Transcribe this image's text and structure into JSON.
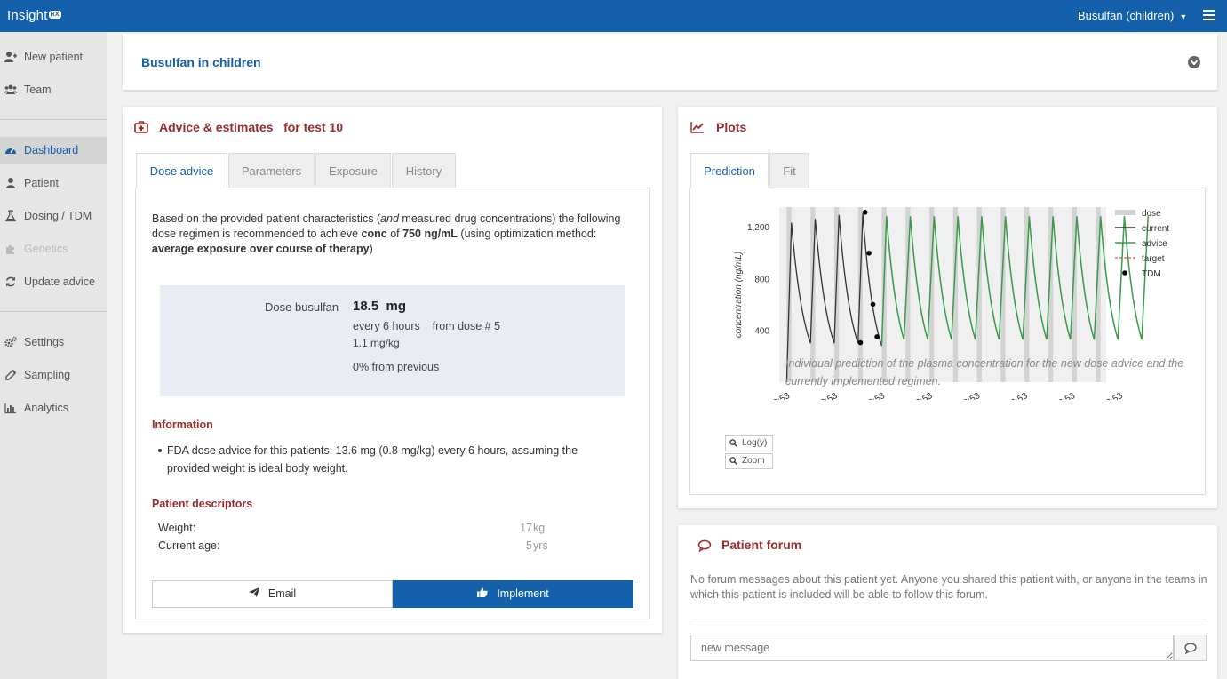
{
  "app": {
    "logo_text": "Insight",
    "logo_badge": "RX",
    "model_selector": "Busulfan (children)"
  },
  "sidebar": {
    "items": [
      {
        "label": "New patient",
        "icon": "add-user-icon"
      },
      {
        "label": "Team",
        "icon": "team-icon"
      },
      {
        "label": "Dashboard",
        "icon": "dashboard-icon",
        "active": true
      },
      {
        "label": "Patient",
        "icon": "user-icon"
      },
      {
        "label": "Dosing / TDM",
        "icon": "flask-icon"
      },
      {
        "label": "Genetics",
        "icon": "puzzle-icon",
        "disabled": true
      },
      {
        "label": "Update advice",
        "icon": "refresh-icon"
      },
      {
        "label": "Settings",
        "icon": "gears-icon"
      },
      {
        "label": "Sampling",
        "icon": "eyedropper-icon"
      },
      {
        "label": "Analytics",
        "icon": "bar-chart-icon"
      }
    ]
  },
  "page_title": "Busulfan in children",
  "advice": {
    "heading": "Advice & estimates",
    "heading_for": "for test 10",
    "tabs": [
      "Dose advice",
      "Parameters",
      "Exposure",
      "History"
    ],
    "active_tab": "Dose advice",
    "intro_1": "Based on the provided patient characteristics (",
    "intro_and": "and",
    "intro_2": " measured drug concentrations)  the following dose regimen is recommended to achieve ",
    "intro_target_name": "conc",
    "intro_3": "  of ",
    "intro_target_value": "750 ng/mL",
    "intro_4": "  (using optimization method: ",
    "intro_method": "average exposure over course of therapy",
    "intro_5": ")",
    "dose_label": "Dose busulfan",
    "dose_value": "18.5  mg",
    "dose_interval": "every 6 hours    from dose # 5",
    "dose_per_kg": "1.1 mg/kg",
    "dose_change": "0% from previous",
    "information_heading": "Information",
    "information_bullet": "FDA dose advice for this patients: 13.6 mg (0.8 mg/kg) every 6 hours, assuming the provided weight is ideal body weight.",
    "descriptors_heading": "Patient descriptors",
    "descriptors": [
      {
        "label": "Weight:",
        "value": "17",
        "unit": "kg"
      },
      {
        "label": "Current age:",
        "value": "5",
        "unit": "yrs"
      }
    ],
    "email_button": "Email",
    "implement_button": "Implement"
  },
  "plots": {
    "heading": "Plots",
    "tabs": [
      "Prediction",
      "Fit"
    ],
    "active_tab": "Prediction",
    "log_button": "Log(y)",
    "zoom_button": "Zoom",
    "caption": "Individual prediction of the plasma concentration for the new dose advice and the currently implemented regimen."
  },
  "chart_data": {
    "type": "line",
    "ylabel": "concentration (ng/mL)",
    "yticks": [
      400,
      800,
      1200
    ],
    "ylim": [
      0,
      1350
    ],
    "xlim": [
      "12/03 09:00",
      "12/06 19:30"
    ],
    "xticks": [
      "12/03 10:53",
      "12/03 22:53",
      "12/04 10:53",
      "12/04 22:53",
      "12/05 10:53",
      "12/05 22:53",
      "12/06 10:53",
      "12/06 22:53"
    ],
    "legend": [
      "dose",
      "current",
      "advice",
      "target",
      "TDM"
    ],
    "legend_position": "right",
    "colors": {
      "dose": "#d3d3d3",
      "current": "#333333",
      "advice": "#3a9a4a",
      "target": "#d9534f",
      "TDM": "#000000"
    },
    "dose_times": [
      "12/03 10:53",
      "12/03 16:53",
      "12/03 22:53",
      "12/04 04:53",
      "12/04 10:53",
      "12/04 16:53",
      "12/04 22:53",
      "12/05 04:53",
      "12/05 10:53",
      "12/05 16:53",
      "12/05 22:53",
      "12/06 04:53",
      "12/06 10:53",
      "12/06 16:53",
      "12/06 22:53",
      "12/07 04:53"
    ],
    "series": [
      {
        "name": "current",
        "peaks": [
          {
            "time": "12/03 10:53",
            "trough": 0,
            "peak": 1230,
            "next_trough": 300
          },
          {
            "time": "12/03 16:53",
            "peak": 1260,
            "next_trough": 300
          },
          {
            "time": "12/03 22:53",
            "peak": 1290,
            "next_trough": 300
          },
          {
            "time": "12/04 04:53",
            "peak": 1300,
            "next_trough": 280
          }
        ]
      },
      {
        "name": "advice",
        "peak": 1280,
        "trough": 290,
        "from": "12/04 10:53",
        "last_dose": "12/07 04:53",
        "final_value": 0
      }
    ],
    "tdm": [
      {
        "time": "12/04 05:30",
        "value": 305
      },
      {
        "time": "12/04 06:40",
        "value": 1310
      },
      {
        "time": "12/04 07:40",
        "value": 995
      },
      {
        "time": "12/04 08:40",
        "value": 600
      },
      {
        "time": "12/04 09:40",
        "value": 350
      }
    ]
  },
  "forum": {
    "heading": "Patient forum",
    "empty_text": "No forum messages about this patient yet. Anyone you shared this patient with, or anyone in the teams in which this patient is included will be able to follow this forum.",
    "input_placeholder": "new message"
  }
}
